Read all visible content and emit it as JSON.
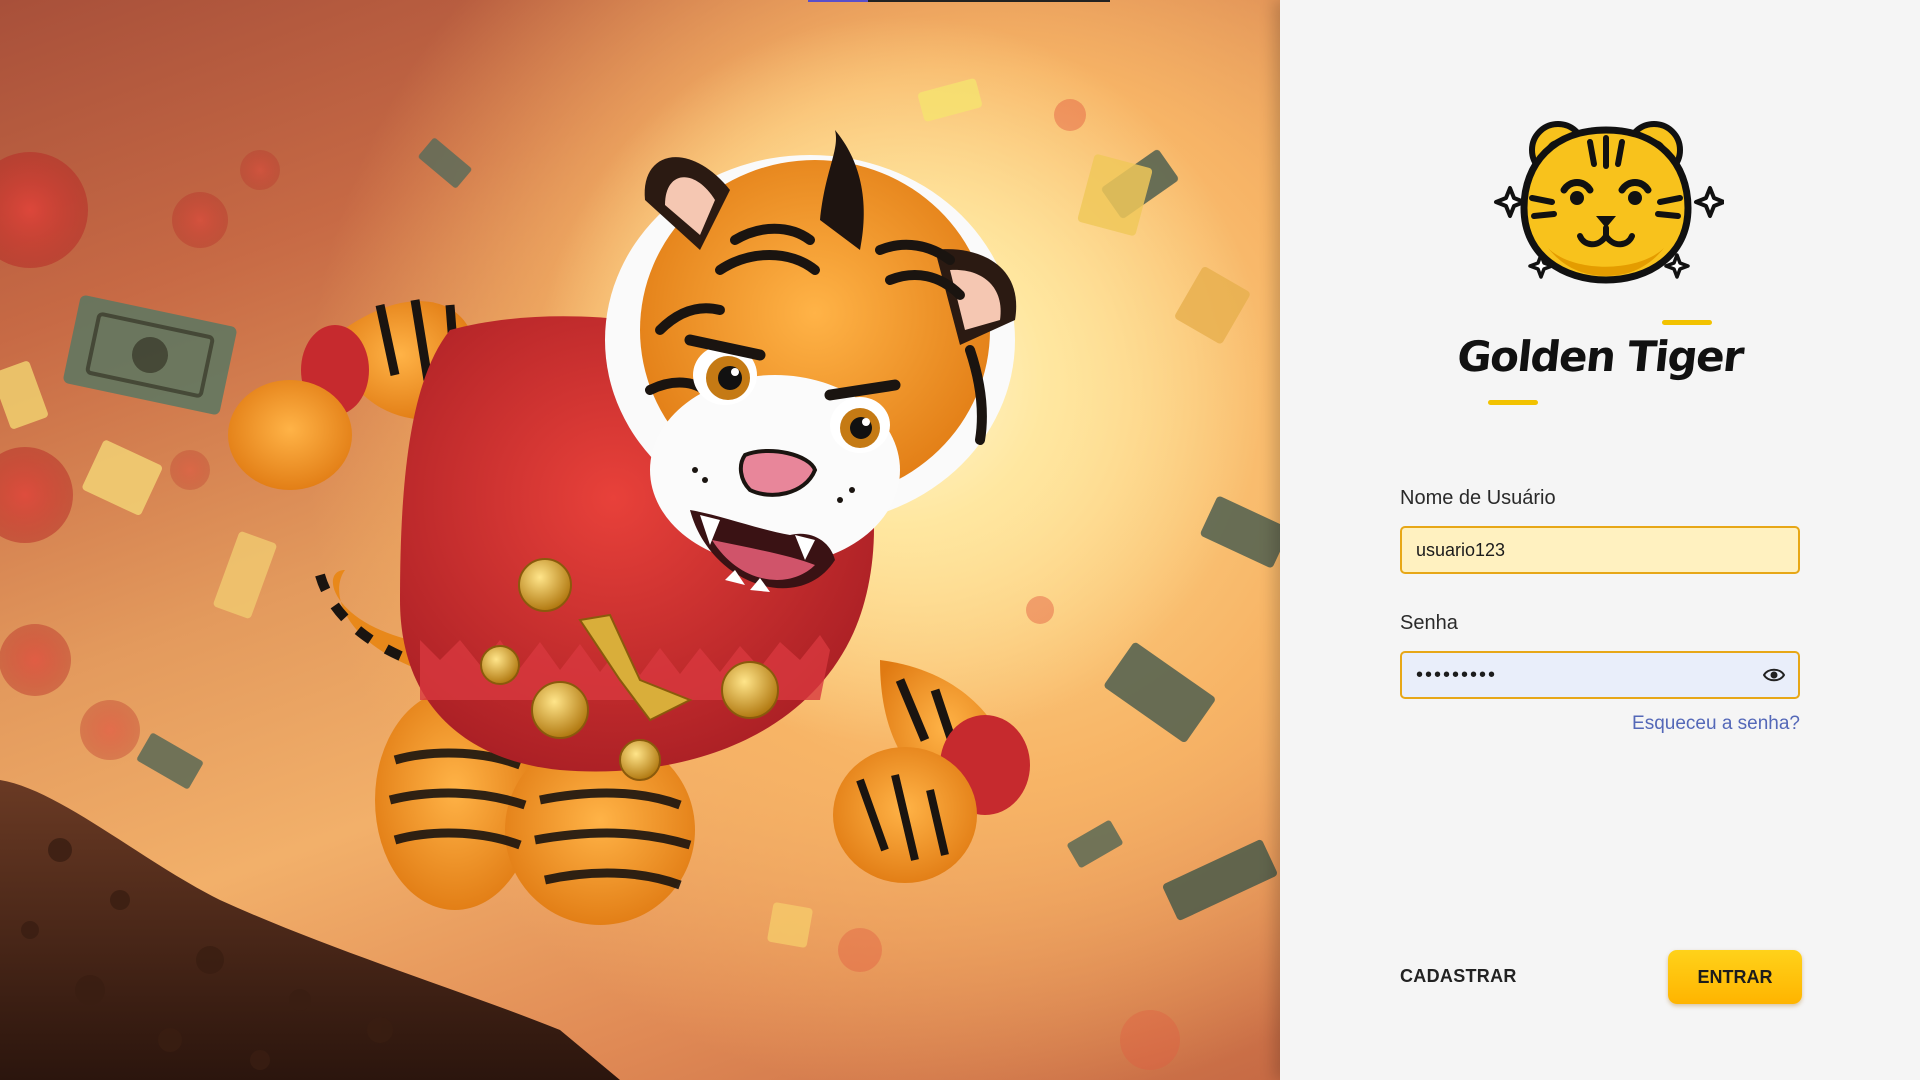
{
  "brand": {
    "name": "Golden Tiger",
    "accent_color": "#f2c200",
    "logo_icon": "tiger-face-icon"
  },
  "hero": {
    "image": "tiger-mascot-running-illustration"
  },
  "form": {
    "username_label": "Nome de Usuário",
    "username_value": "usuario123",
    "password_label": "Senha",
    "password_value": "•••••••••",
    "password_toggle_icon": "eye-icon",
    "forgot_password": "Esqueceu a senha?"
  },
  "actions": {
    "register_label": "CADASTRAR",
    "login_label": "ENTRAR",
    "login_color": "#ffbf00"
  }
}
